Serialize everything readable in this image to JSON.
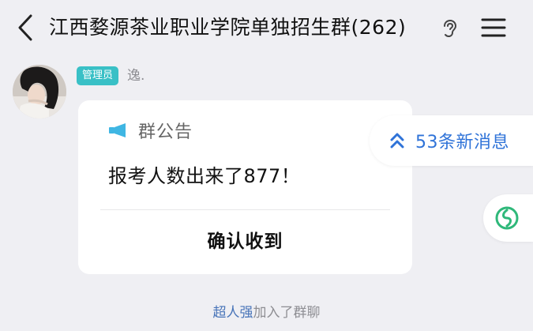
{
  "header": {
    "title": "江西婺源茶业职业学院单独招生群(262)",
    "back_icon": "chevron-left-icon",
    "ear_icon": "ear-icon",
    "menu_icon": "hamburger-menu-icon"
  },
  "message": {
    "role_badge": "管理员",
    "sender_name": "逸.",
    "announcement": {
      "icon": "megaphone-icon",
      "title": "群公告",
      "content": "报考人数出来了877！",
      "confirm_label": "确认收到"
    }
  },
  "new_messages": {
    "icon": "double-chevron-up-icon",
    "label": "53条新消息"
  },
  "floating_button": {
    "icon": "green-circle-logo-icon"
  },
  "system_message": {
    "user": "超人强",
    "action": "加入了群聊"
  },
  "colors": {
    "background": "#efeff3",
    "badge": "#39c0c6",
    "accent_blue": "#2f73d8",
    "link_blue": "#4874b8",
    "green": "#2fb87a"
  }
}
